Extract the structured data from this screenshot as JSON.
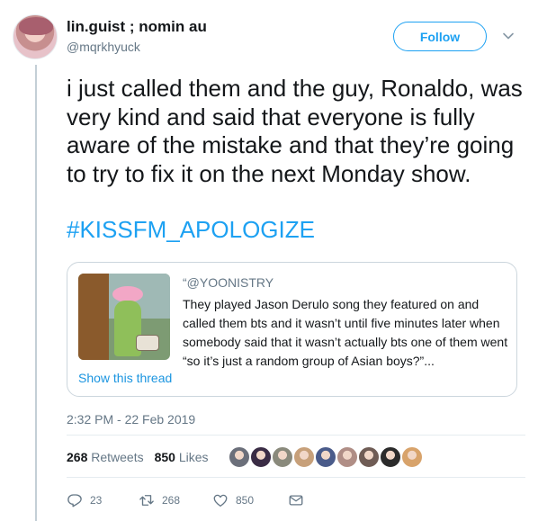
{
  "user": {
    "display_name": "lin.guist ; nomin au",
    "handle": "@mqrkhyuck"
  },
  "follow_label": "Follow",
  "tweet": {
    "text": "i just called them and the guy, Ronaldo, was very kind and said that everyone is fully aware of the mistake and that they’re going to try to fix it on the next Monday show.",
    "hashtag": "#KISSFM_APOLOGIZE"
  },
  "quote": {
    "author": "“@YOONISTRY",
    "text": "They played Jason Derulo song they featured on and called them bts and it wasn’t until five minutes later when somebody said that it wasn’t actually bts one of them went “so it’s just a random group of Asian boys?”...",
    "show_thread": "Show this thread"
  },
  "timestamp": "2:32 PM - 22 Feb 2019",
  "stats": {
    "retweets_count": "268",
    "retweets_label": "Retweets",
    "likes_count": "850",
    "likes_label": "Likes"
  },
  "liker_avatar_colors": [
    "#6b6f7a",
    "#3a2c45",
    "#8a8a7c",
    "#c7a07a",
    "#4a5b8a",
    "#b08e86",
    "#6f5c55",
    "#2b2b2b",
    "#d8a36b"
  ],
  "actions": {
    "reply_count": "23",
    "retweet_count": "268",
    "like_count": "850"
  },
  "icons": [
    "caret-down-icon",
    "reply-icon",
    "retweet-icon",
    "heart-icon",
    "direct-message-icon"
  ],
  "colors": {
    "accent": "#1da1f2",
    "text": "#14171a",
    "secondary_text": "#657786",
    "thread_line": "#c4cfd6"
  }
}
